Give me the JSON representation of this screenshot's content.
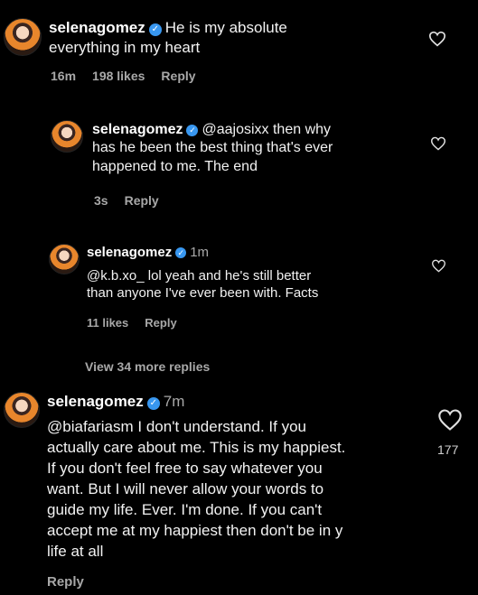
{
  "comments": [
    {
      "username": "selenagomez",
      "text_line1": "He is my absolute",
      "text_line2": "everything in my heart",
      "time": "16m",
      "likes": "198 likes",
      "reply_label": "Reply"
    },
    {
      "username": "selenagomez",
      "text_line1": "@aajosixx then why",
      "text_line2": "has he been the best thing that's ever",
      "text_line3": "happened to me. The end",
      "time": "3s",
      "reply_label": "Reply"
    },
    {
      "username": "selenagomez",
      "time": "1m",
      "text_line1": "@k.b.xo_ lol yeah and he's still better",
      "text_line2": "than anyone I've ever been with. Facts",
      "likes": "11 likes",
      "reply_label": "Reply"
    },
    {
      "username": "selenagomez",
      "time": "7m",
      "text_line1": "@biafariasm I don't understand. If you",
      "text_line2": "actually care about me. This is my happiest.",
      "text_line3": "If you don't feel free to say whatever you",
      "text_line4": "want. But I will never allow your words to",
      "text_line5": "guide my life. Ever. I'm done. If you can't",
      "text_line6": "accept me at my happiest then don't be in y",
      "text_line7": "life at all",
      "like_count": "177",
      "reply_label": "Reply"
    }
  ],
  "view_more_replies": "View 34 more replies",
  "icons": {
    "verified": "verified-badge-icon",
    "like": "heart-outline-icon"
  },
  "colors": {
    "verified": "#3897f0",
    "meta": "#a8a8a8",
    "background": "#000000"
  }
}
